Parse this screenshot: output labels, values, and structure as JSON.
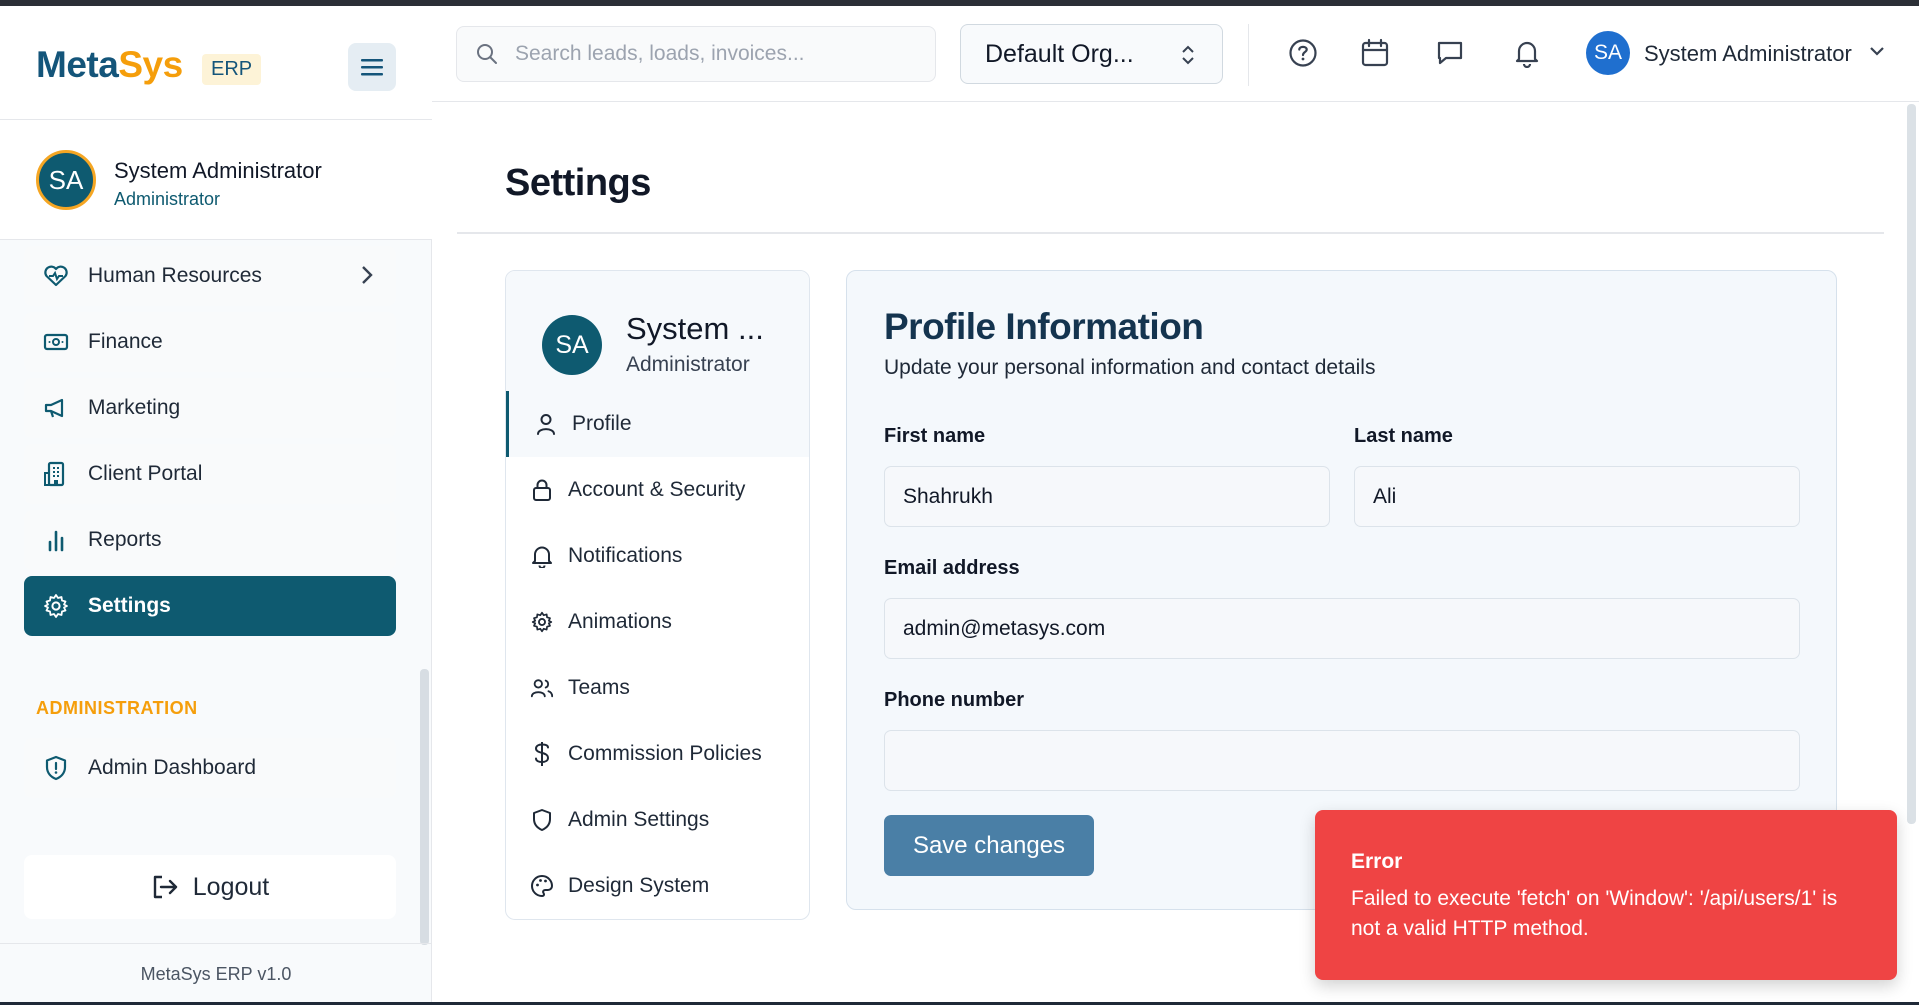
{
  "brand": {
    "name_part1": "Meta",
    "name_part2": "Sys",
    "badge": "ERP"
  },
  "sidebar": {
    "user": {
      "initials": "SA",
      "name": "System Administrator",
      "role": "Administrator"
    },
    "items": [
      {
        "label": "Human Resources",
        "icon": "heart-pulse-icon"
      },
      {
        "label": "Finance",
        "icon": "banknote-icon"
      },
      {
        "label": "Marketing",
        "icon": "megaphone-icon"
      },
      {
        "label": "Client Portal",
        "icon": "building-icon"
      },
      {
        "label": "Reports",
        "icon": "bar-chart-icon"
      },
      {
        "label": "Settings",
        "icon": "gear-icon",
        "active": true
      }
    ],
    "admin_section_label": "ADMINISTRATION",
    "admin_items": [
      {
        "label": "Admin Dashboard",
        "icon": "shield-alert-icon"
      }
    ],
    "logout_label": "Logout",
    "footer": "MetaSys ERP v1.0"
  },
  "topbar": {
    "search_placeholder": "Search leads, loads, invoices...",
    "org_selector": "Default Org...",
    "user_initials": "SA",
    "user_name": "System Administrator"
  },
  "page": {
    "title": "Settings"
  },
  "settings_nav": {
    "user_initials": "SA",
    "user_name": "System ...",
    "user_role": "Administrator",
    "items": [
      {
        "label": "Profile",
        "icon": "user-icon",
        "active": true
      },
      {
        "label": "Account & Security",
        "icon": "lock-icon"
      },
      {
        "label": "Notifications",
        "icon": "bell-icon"
      },
      {
        "label": "Animations",
        "icon": "gear-icon"
      },
      {
        "label": "Teams",
        "icon": "users-icon"
      },
      {
        "label": "Commission Policies",
        "icon": "dollar-icon"
      },
      {
        "label": "Admin Settings",
        "icon": "shield-icon"
      },
      {
        "label": "Design System",
        "icon": "palette-icon"
      }
    ]
  },
  "profile": {
    "title": "Profile Information",
    "subtitle": "Update your personal information and contact details",
    "first_name_label": "First name",
    "first_name": "Shahrukh",
    "last_name_label": "Last name",
    "last_name": "Ali",
    "email_label": "Email address",
    "email": "admin@metasys.com",
    "phone_label": "Phone number",
    "phone": "",
    "save_label": "Save changes"
  },
  "toast": {
    "title": "Error",
    "message": "Failed to execute 'fetch' on 'Window': '/api/users/1' is not a valid HTTP method."
  },
  "colors": {
    "primary": "#0e5a70",
    "accent": "#f59e0b",
    "button": "#4a7fa6",
    "error": "#ef4444"
  }
}
